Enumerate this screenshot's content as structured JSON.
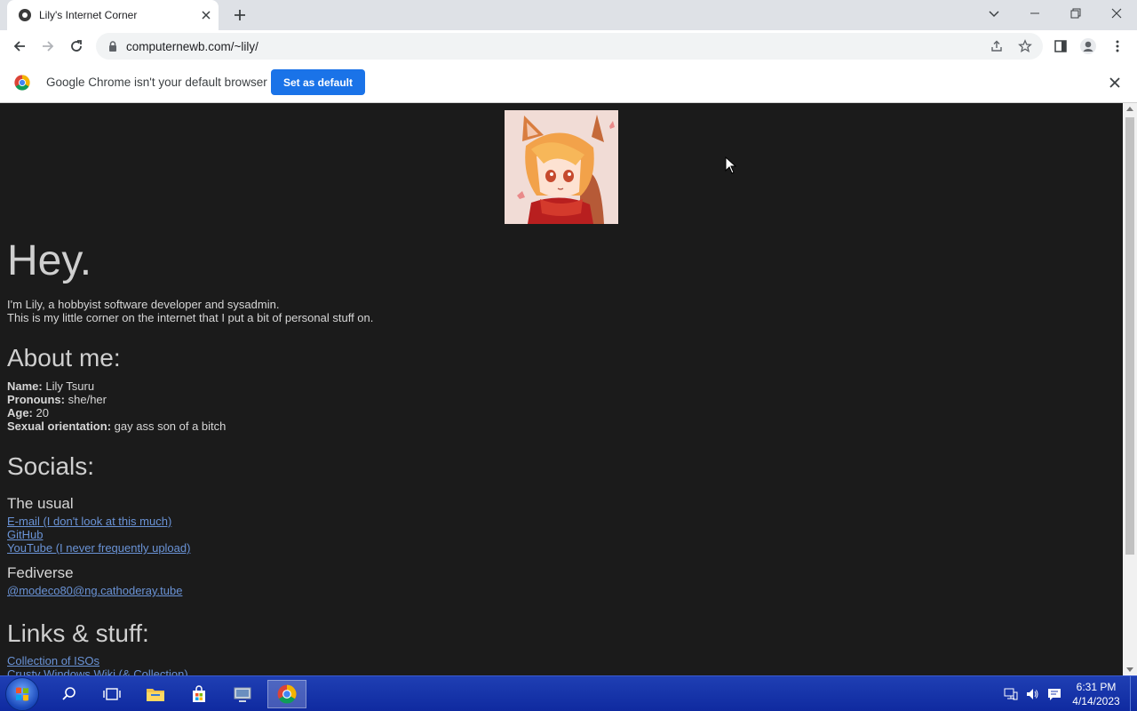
{
  "browser": {
    "tab_title": "Lily's Internet Corner",
    "url": "computernewb.com/~lily/",
    "infobar_text": "Google Chrome isn't your default browser",
    "set_default_label": "Set as default"
  },
  "page": {
    "heading": "Hey.",
    "intro_line1": "I'm Lily, a hobbyist software developer and sysadmin.",
    "intro_line2": "This is my little corner on the internet that I put a bit of personal stuff on.",
    "about_heading": "About me:",
    "facts": [
      {
        "label": "Name:",
        "value": "Lily Tsuru"
      },
      {
        "label": "Pronouns:",
        "value": "she/her"
      },
      {
        "label": "Age:",
        "value": "20"
      },
      {
        "label": "Sexual orientation:",
        "value": "gay ass son of a bitch"
      }
    ],
    "socials_heading": "Socials:",
    "usual_heading": "The usual",
    "usual_links": [
      "E-mail (I don't look at this much)",
      "GitHub",
      "YouTube (I never frequently upload)"
    ],
    "fediverse_heading": "Fediverse",
    "fediverse_links": [
      "@modeco80@ng.cathoderay.tube"
    ],
    "links_heading": "Links & stuff:",
    "stuff_links": [
      "Collection of ISOs",
      "Crusty Windows Wiki (& Collection)"
    ]
  },
  "taskbar": {
    "time": "6:31 PM",
    "date": "4/14/2023"
  },
  "colors": {
    "page_bg": "#1b1b1b",
    "link": "#6a93d6",
    "chrome_blue": "#1a73e8",
    "taskbar": "#1f3fb3"
  },
  "icons": [
    "favicon-icon",
    "close-icon",
    "plus-icon",
    "chevron-down-icon",
    "minimize-icon",
    "restore-icon",
    "back-icon",
    "forward-icon",
    "reload-icon",
    "lock-icon",
    "share-icon",
    "star-icon",
    "side-panel-icon",
    "profile-icon",
    "kebab-menu-icon",
    "chrome-logo-icon",
    "start-orb-icon",
    "search-icon",
    "task-view-icon",
    "file-explorer-icon",
    "store-icon",
    "app-icon",
    "chrome-icon",
    "network-icon",
    "volume-icon",
    "notification-icon"
  ]
}
